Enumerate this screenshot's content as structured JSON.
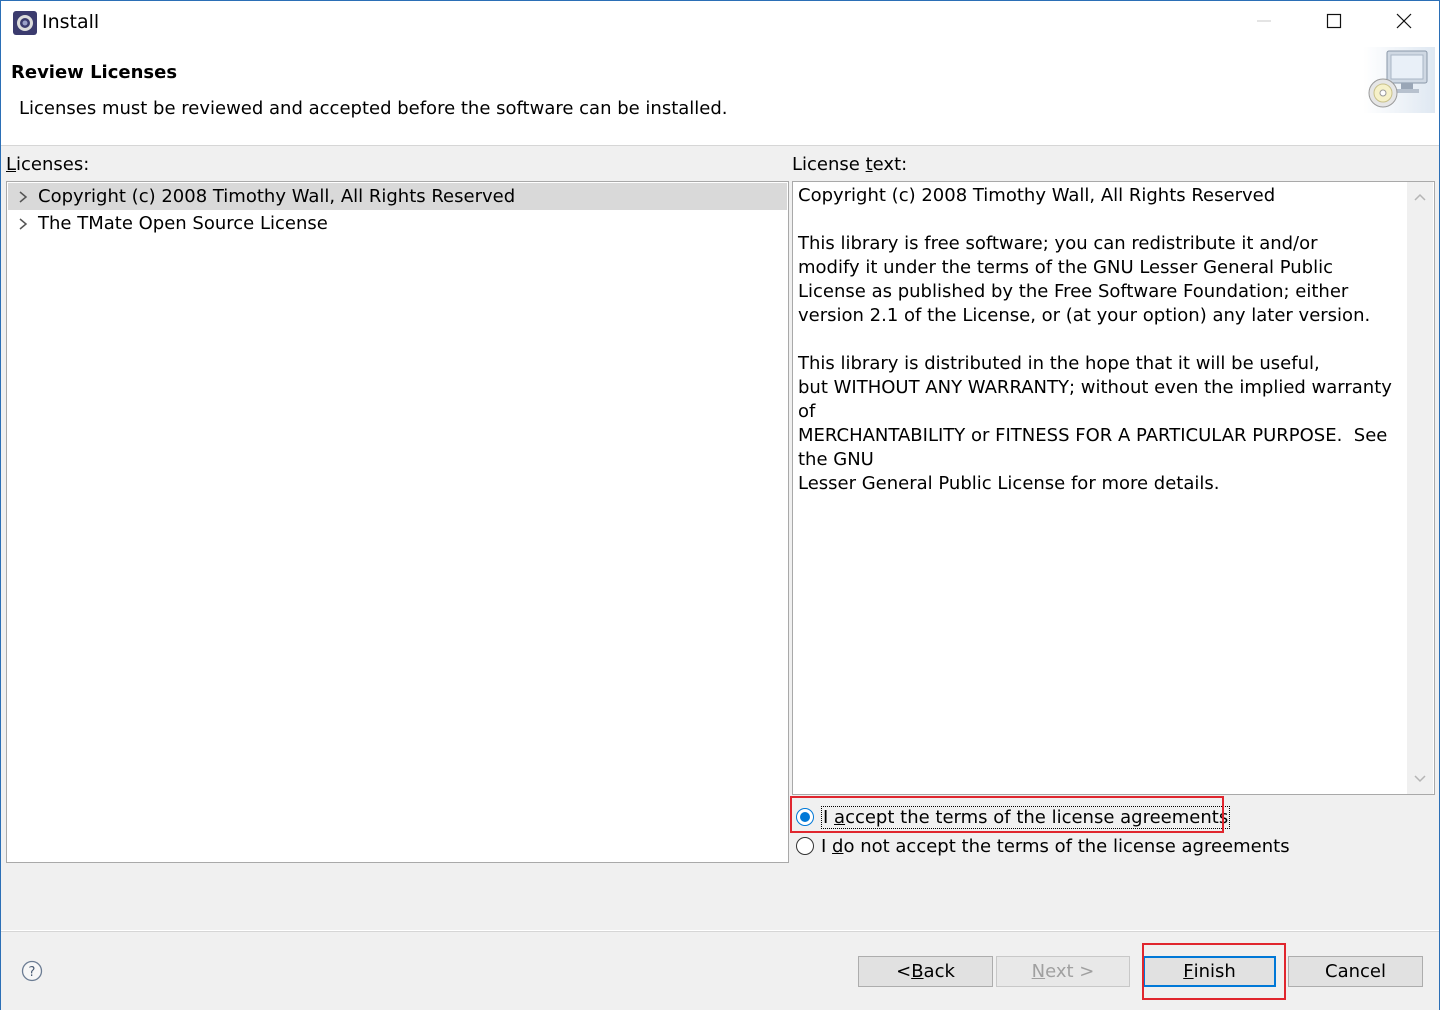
{
  "window": {
    "title": "Install",
    "controls": [
      "minimize",
      "maximize",
      "close"
    ]
  },
  "header": {
    "title": "Review Licenses",
    "description": "Licenses must be reviewed and accepted before the software can be installed."
  },
  "licenses_panel": {
    "label": "Licenses:",
    "label_mnemonic": "L",
    "label_rest": "icenses:",
    "items": [
      {
        "label": "Copyright (c) 2008 Timothy Wall, All Rights Reserved",
        "selected": true
      },
      {
        "label": "The TMate Open Source License",
        "selected": false
      }
    ]
  },
  "license_text_panel": {
    "label_pre": "License ",
    "label_mnemonic": "t",
    "label_post": "ext:",
    "content": "Copyright (c) 2008 Timothy Wall, All Rights Reserved\n\nThis library is free software; you can redistribute it and/or\nmodify it under the terms of the GNU Lesser General Public\nLicense as published by the Free Software Foundation; either\nversion 2.1 of the License, or (at your option) any later version.\n\nThis library is distributed in the hope that it will be useful,\nbut WITHOUT ANY WARRANTY; without even the implied warranty of\nMERCHANTABILITY or FITNESS FOR A PARTICULAR PURPOSE.  See\nthe GNU\nLesser General Public License for more details."
  },
  "agreement": {
    "accept": {
      "pre": "I ",
      "mnemonic": "a",
      "post": "ccept the terms of the license agreements",
      "checked": true
    },
    "decline": {
      "pre": "I ",
      "mnemonic": "d",
      "post": "o not accept the terms of the license agreements",
      "checked": false
    }
  },
  "footer": {
    "back": {
      "pre": "< ",
      "mnemonic": "B",
      "post": "ack"
    },
    "next": {
      "pre": "",
      "mnemonic": "N",
      "post": "ext >",
      "disabled": true
    },
    "finish": {
      "pre": "",
      "mnemonic": "F",
      "post": "inish"
    },
    "cancel": {
      "label": "Cancel"
    }
  },
  "colors": {
    "accent": "#0078d7",
    "highlight": "#e0262e",
    "selection": "#d9d9d9",
    "dialog_bg": "#f0f0f0"
  }
}
